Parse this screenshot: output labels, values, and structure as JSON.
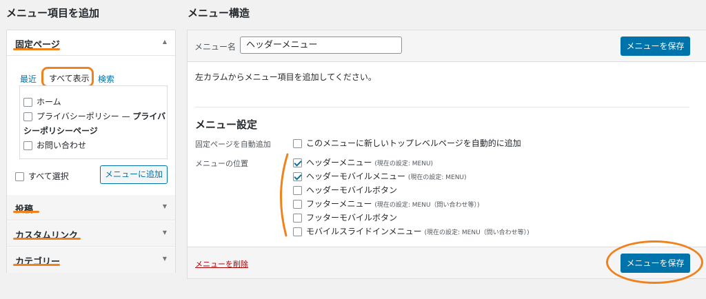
{
  "left": {
    "title": "メニュー項目を追加",
    "sections": [
      {
        "label": "固定ページ",
        "state": "expanded"
      },
      {
        "label": "投稿",
        "state": "collapsed"
      },
      {
        "label": "カスタムリンク",
        "state": "collapsed"
      },
      {
        "label": "カテゴリー",
        "state": "collapsed"
      }
    ],
    "tabs": {
      "recent": "最近",
      "all": "すべて表示",
      "search": "検索"
    },
    "pages": [
      {
        "label": "ホーム",
        "checked": false
      },
      {
        "label": "プライバシーポリシー",
        "suffix": "—",
        "bold": "プライバ",
        "bold2": "シーポリシーページ",
        "checked": false
      },
      {
        "label": "お問い合わせ",
        "checked": false
      }
    ],
    "select_all": "すべて選択",
    "add_button": "メニューに追加"
  },
  "right": {
    "title": "メニュー構造",
    "menu_name_label": "メニュー名",
    "menu_name_value": "ヘッダーメニュー",
    "save_button": "メニューを保存",
    "hint": "左カラムからメニュー項目を追加してください。",
    "settings_title": "メニュー設定",
    "auto_add_label": "固定ページを自動追加",
    "auto_add_option": "このメニューに新しいトップレベルページを自動的に追加",
    "location_label": "メニューの位置",
    "locations": [
      {
        "label": "ヘッダーメニュー",
        "note": "(現在の設定: MENU)",
        "checked": true
      },
      {
        "label": "ヘッダーモバイルメニュー",
        "note": "(現在の設定: MENU)",
        "checked": true
      },
      {
        "label": "ヘッダーモバイルボタン",
        "note": "",
        "checked": false
      },
      {
        "label": "フッターメニュー",
        "note": "(現在の設定: MENU（問い合わせ等）)",
        "checked": false
      },
      {
        "label": "フッターモバイルボタン",
        "note": "",
        "checked": false
      },
      {
        "label": "モバイルスライドインメニュー",
        "note": "(現在の設定: MENU（問い合わせ等）)",
        "checked": false
      }
    ],
    "delete_link": "メニューを削除",
    "save_button_bottom": "メニューを保存"
  },
  "icons": {
    "expanded_arrow": "▲",
    "collapsed_arrow": "▼"
  },
  "colors": {
    "accent": "#0073aa",
    "annotation": "#f0821e",
    "danger": "#aa0000"
  }
}
